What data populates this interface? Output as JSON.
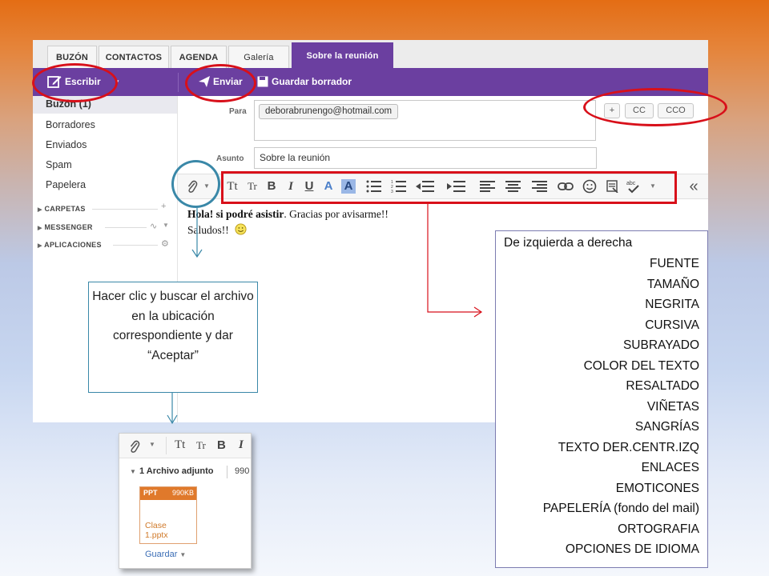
{
  "tabs": [
    {
      "label": "BUZÓN"
    },
    {
      "label": "CONTACTOS"
    },
    {
      "label": "AGENDA"
    },
    {
      "label": "Galería"
    },
    {
      "label": "Sobre la reunión"
    }
  ],
  "toolbar": {
    "compose": "Escribir",
    "send": "Enviar",
    "save_draft": "Guardar borrador"
  },
  "sidebar": {
    "items": [
      "Buzón (1)",
      "Borradores",
      "Enviados",
      "Spam",
      "Papelera"
    ],
    "sections": [
      "CARPETAS",
      "MESSENGER",
      "APLICACIONES"
    ]
  },
  "compose": {
    "to_label": "Para",
    "to_chip": "deborabrunengo@hotmail.com",
    "cc": "CC",
    "bcc": "CCO",
    "subject_label": "Asunto",
    "subject": "Sobre la reunión",
    "body_bold": "Hola! si podré asistir",
    "body_rest": ". Gracias por avisarme!!",
    "body_line2": "Saludos!!"
  },
  "note_left": "Hacer clic y buscar el archivo en la ubicación correspondiente  y dar “Aceptar”",
  "note_right": {
    "heading": "De izquierda a derecha",
    "items": [
      "FUENTE",
      "TAMAÑO",
      "NEGRITA",
      "CURSIVA",
      "SUBRAYADO",
      "COLOR DEL TEXTO",
      "RESALTADO",
      "VIÑETAS",
      "SANGRÍAS",
      "TEXTO  DER.CENTR.IZQ",
      "ENLACES",
      "EMOTICONES",
      "PAPELERÍA  (fondo del mail)",
      "ORTOGRAFIA",
      "OPCIONES DE IDIOMA"
    ]
  },
  "attachment_panel": {
    "count_label": "1 Archivo adjunto",
    "size_partial": "990",
    "file_type": "PPT",
    "file_size": "990KB",
    "file_name_1": "Clase",
    "file_name_2": "1.pptx",
    "save": "Guardar"
  },
  "colors": {
    "toolbar": "#6b3fa0",
    "highlight_ellipse": "#d8101a",
    "attach_ellipse": "#3a88a8",
    "ppt": "#e0792b"
  }
}
